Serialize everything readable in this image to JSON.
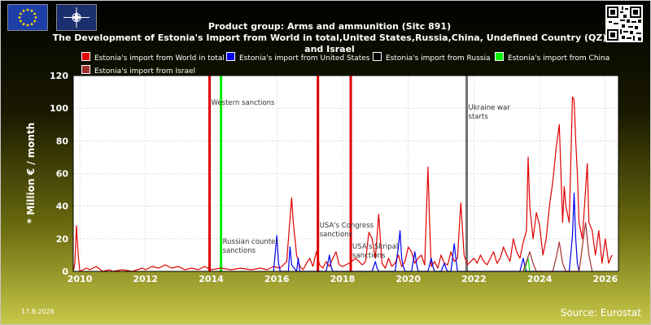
{
  "header": {
    "title_line1": "Product group: Arms and ammunition (Sitc 891)",
    "title_line2": "The Development of Estonia's Import from World in total,United States,Russia,China, Undefined Country (QZ) and Israel",
    "date": "17.8.2026",
    "source": "Source: Eurostat"
  },
  "colors": {
    "world": "#e00000",
    "usa": "#0000ee",
    "russia": "#000000",
    "china": "#00ee00",
    "israel": "#a03030",
    "marker_gray": "#707070"
  },
  "chart_data": {
    "type": "line",
    "ylabel": "* Million € / month",
    "xlabel": "",
    "xlim": [
      2009.8,
      2026.4
    ],
    "ylim": [
      0,
      120
    ],
    "x_ticks": [
      2010,
      2012,
      2014,
      2016,
      2018,
      2020,
      2022,
      2024,
      2026
    ],
    "x_tick_labels": [
      "2010",
      "2012",
      "2014",
      "2016",
      "2018",
      "2020",
      "2022",
      "2024",
      "2026"
    ],
    "y_ticks": [
      0,
      20,
      40,
      60,
      80,
      100,
      120
    ],
    "y_tick_labels": [
      "0",
      "20",
      "40",
      "60",
      "80",
      "100",
      "120"
    ],
    "grid": true,
    "legend_placement": "top",
    "series": [
      {
        "name": "Estonia's import from World in total",
        "color": "#e00000",
        "x": [
          2009.8,
          2009.85,
          2009.9,
          2009.95,
          2010.0,
          2010.2,
          2010.3,
          2010.5,
          2010.7,
          2010.9,
          2011.0,
          2011.3,
          2011.6,
          2011.9,
          2012.0,
          2012.2,
          2012.4,
          2012.6,
          2012.8,
          2013.0,
          2013.2,
          2013.4,
          2013.6,
          2013.8,
          2014.0,
          2014.3,
          2014.6,
          2014.9,
          2015.2,
          2015.5,
          2015.7,
          2015.9,
          2016.1,
          2016.3,
          2016.45,
          2016.5,
          2016.6,
          2016.7,
          2016.8,
          2016.9,
          2017.0,
          2017.1,
          2017.2,
          2017.3,
          2017.4,
          2017.5,
          2017.6,
          2017.7,
          2017.8,
          2017.9,
          2018.0,
          2018.2,
          2018.4,
          2018.6,
          2018.7,
          2018.8,
          2018.9,
          2019.0,
          2019.1,
          2019.2,
          2019.3,
          2019.4,
          2019.5,
          2019.6,
          2019.7,
          2019.8,
          2019.9,
          2020.0,
          2020.1,
          2020.2,
          2020.3,
          2020.4,
          2020.5,
          2020.6,
          2020.65,
          2020.7,
          2020.8,
          2020.9,
          2021.0,
          2021.1,
          2021.2,
          2021.3,
          2021.4,
          2021.5,
          2021.6,
          2021.7,
          2021.8,
          2021.9,
          2022.0,
          2022.1,
          2022.2,
          2022.3,
          2022.4,
          2022.5,
          2022.6,
          2022.7,
          2022.8,
          2022.9,
          2023.0,
          2023.1,
          2023.2,
          2023.3,
          2023.4,
          2023.5,
          2023.6,
          2023.65,
          2023.7,
          2023.8,
          2023.9,
          2024.0,
          2024.1,
          2024.2,
          2024.3,
          2024.4,
          2024.5,
          2024.6,
          2024.7,
          2024.75,
          2024.8,
          2024.9,
          2025.0,
          2025.05,
          2025.1,
          2025.15,
          2025.2,
          2025.3,
          2025.4,
          2025.45,
          2025.5,
          2025.6,
          2025.7,
          2025.8,
          2025.9,
          2026.0,
          2026.1,
          2026.2
        ],
        "values": [
          0,
          5,
          28,
          10,
          0,
          2,
          1,
          3,
          0,
          1,
          0,
          1,
          0,
          2,
          1,
          3,
          2,
          4,
          2,
          3,
          1,
          2,
          1,
          3,
          1,
          2,
          1,
          2,
          1,
          2,
          1,
          3,
          2,
          6,
          45,
          30,
          10,
          3,
          1,
          5,
          8,
          3,
          12,
          4,
          2,
          6,
          3,
          8,
          12,
          4,
          3,
          5,
          8,
          4,
          6,
          24,
          20,
          8,
          35,
          5,
          2,
          8,
          3,
          5,
          10,
          3,
          6,
          15,
          12,
          5,
          8,
          10,
          4,
          64,
          30,
          3,
          6,
          2,
          10,
          5,
          4,
          12,
          6,
          8,
          42,
          10,
          4,
          6,
          8,
          5,
          10,
          6,
          4,
          8,
          12,
          5,
          8,
          15,
          10,
          6,
          20,
          12,
          8,
          18,
          25,
          70,
          40,
          20,
          36,
          28,
          10,
          20,
          40,
          55,
          75,
          90,
          30,
          52,
          40,
          30,
          107,
          105,
          80,
          60,
          30,
          20,
          50,
          66,
          30,
          25,
          10,
          25,
          5,
          20,
          5,
          10
        ],
        "width": 1.2
      },
      {
        "name": "Estonia's import from United States",
        "color": "#0000ee",
        "x": [
          2015.9,
          2016.0,
          2016.05,
          2016.1,
          2016.35,
          2016.4,
          2016.45,
          2016.6,
          2016.65,
          2016.7,
          2017.5,
          2017.6,
          2017.65,
          2017.7,
          2018.9,
          2019.0,
          2019.05,
          2019.1,
          2019.6,
          2019.7,
          2019.75,
          2019.8,
          2019.85,
          2019.9,
          2020.1,
          2020.2,
          2020.25,
          2020.3,
          2020.6,
          2020.7,
          2020.75,
          2020.8,
          2021.0,
          2021.1,
          2021.15,
          2021.2,
          2021.3,
          2021.4,
          2021.45,
          2021.5,
          2023.4,
          2023.5,
          2023.55,
          2023.6,
          2024.9,
          2025.0,
          2025.05,
          2025.1,
          2025.15,
          2025.2
        ],
        "values": [
          0,
          22,
          5,
          0,
          0,
          15,
          4,
          0,
          8,
          0,
          0,
          10,
          3,
          0,
          0,
          6,
          2,
          0,
          0,
          15,
          25,
          8,
          3,
          0,
          0,
          12,
          5,
          0,
          0,
          8,
          3,
          0,
          0,
          5,
          2,
          0,
          0,
          17,
          8,
          0,
          0,
          8,
          3,
          0,
          0,
          22,
          48,
          20,
          5,
          0
        ],
        "width": 1.2
      },
      {
        "name": "Estonia's import from Russia",
        "color": "#000000",
        "x": [],
        "values": [],
        "width": 1.2
      },
      {
        "name": "Estonia's import from China",
        "color": "#00ee00",
        "x": [
          2023.55,
          2023.6,
          2023.65,
          2023.7
        ],
        "values": [
          0,
          5,
          8,
          0
        ],
        "width": 1.2
      },
      {
        "name": "Estonia's import from Israel",
        "color": "#a03030",
        "x": [
          2023.5,
          2023.6,
          2023.7,
          2023.8,
          2023.9,
          2024.0,
          2024.4,
          2024.5,
          2024.6,
          2024.7,
          2024.8,
          2025.2,
          2025.3,
          2025.4,
          2025.5,
          2025.6
        ],
        "values": [
          0,
          6,
          12,
          5,
          0,
          0,
          0,
          8,
          18,
          5,
          0,
          0,
          15,
          30,
          10,
          0
        ],
        "width": 1.2
      }
    ],
    "markers": [
      {
        "x": 2013.95,
        "color": "#e00000",
        "label": "Western sanctions",
        "label_y": 102
      },
      {
        "x": 2014.3,
        "color": "#00ee00",
        "label": "Russian counter sanctions",
        "label_y": 17
      },
      {
        "x": 2017.25,
        "color": "#e00000",
        "label": "USA's Congress sanctions",
        "label_y": 27
      },
      {
        "x": 2018.25,
        "color": "#e00000",
        "label": "USA's Skripal sanctions",
        "label_y": 14
      },
      {
        "x": 2021.78,
        "color": "#707070",
        "label": "Ukraine war starts",
        "label_y": 99
      }
    ]
  }
}
